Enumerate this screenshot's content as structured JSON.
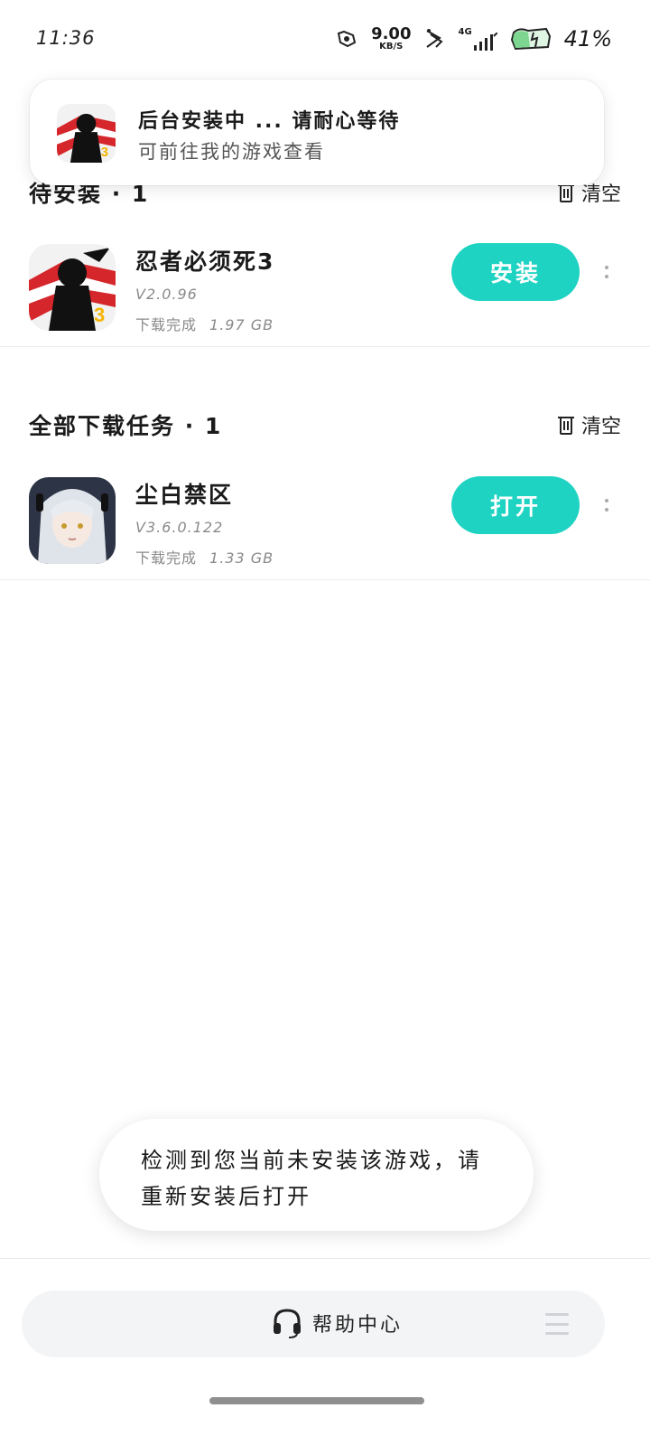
{
  "status_bar": {
    "time": "11:36",
    "net_speed_value": "9.00",
    "net_speed_unit": "KB/S",
    "network_type": "4G",
    "battery_percent": "41%"
  },
  "notification": {
    "title": "后台安装中 ... 请耐心等待",
    "subtitle": "可前往我的游戏查看",
    "icon": "ninja-game-icon"
  },
  "pending_section": {
    "title": "待安装 · 1",
    "clear_label": "清空",
    "items": [
      {
        "name": "忍者必须死3",
        "version": "V2.0.96",
        "status": "下载完成",
        "size": "1.97 GB",
        "action_label": "安装",
        "icon": "ninja-game-icon"
      }
    ]
  },
  "all_tasks_section": {
    "title": "全部下载任务 · 1",
    "clear_label": "清空",
    "items": [
      {
        "name": "尘白禁区",
        "version": "V3.6.0.122",
        "status": "下载完成",
        "size": "1.33 GB",
        "action_label": "打开",
        "icon": "anime-girl-game-icon"
      }
    ]
  },
  "toast": {
    "message": "检测到您当前未安装该游戏，请重新安装后打开"
  },
  "bottom_bar": {
    "help_label": "帮助中心",
    "help_icon": "headset-icon",
    "menu_icon": "menu-icon"
  },
  "colors": {
    "accent": "#1fd3c3",
    "background": "#ffffff",
    "bar_background": "#f3f4f6",
    "muted_text": "#8a8a8a"
  }
}
